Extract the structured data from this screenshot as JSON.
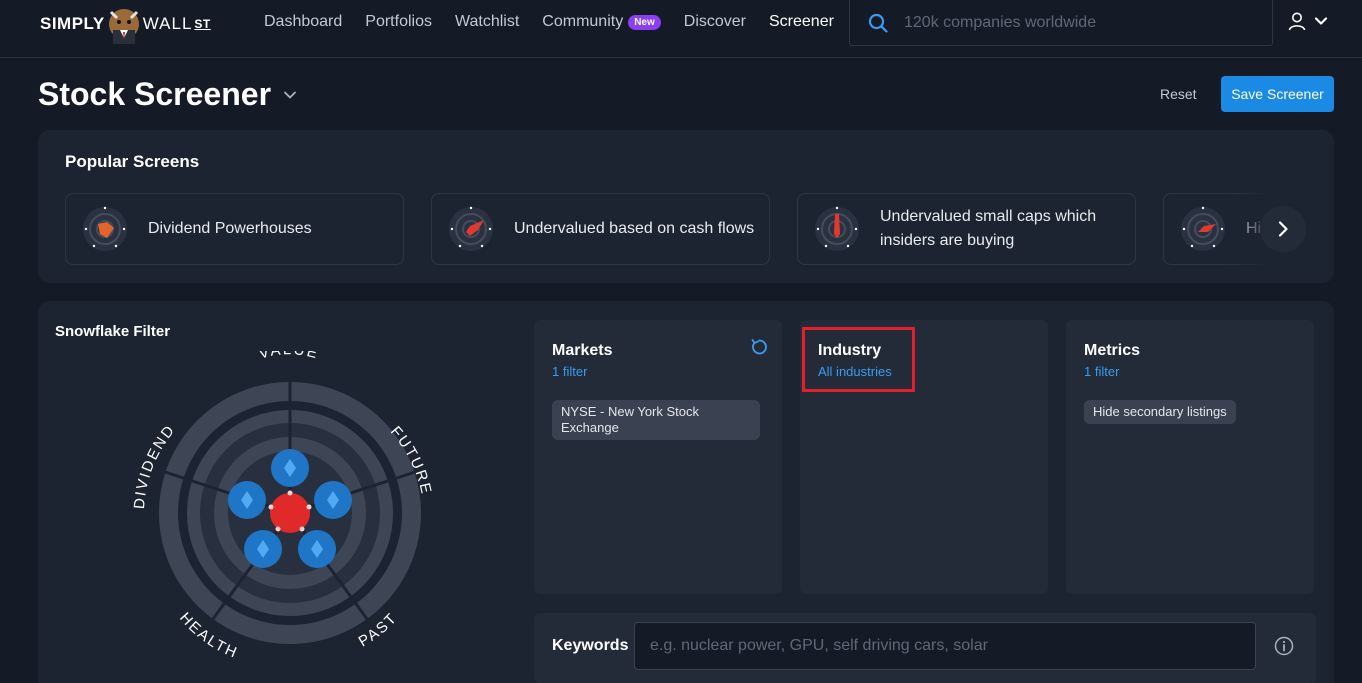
{
  "nav": {
    "logo_left": "SIMPLY",
    "logo_mid": "WALL",
    "logo_right": "ST",
    "links": [
      {
        "label": "Dashboard"
      },
      {
        "label": "Portfolios"
      },
      {
        "label": "Watchlist"
      },
      {
        "label": "Community",
        "badge": "New"
      },
      {
        "label": "Discover"
      },
      {
        "label": "Screener",
        "active": true
      }
    ],
    "search_placeholder": "120k companies worldwide",
    "icons": [
      "search-icon",
      "user-icon",
      "chevron-down-icon"
    ]
  },
  "page": {
    "title": "Stock Screener",
    "reset_label": "Reset",
    "save_label": "Save Screener"
  },
  "popular": {
    "heading": "Popular Screens",
    "screens": [
      {
        "label": "Dividend Powerhouses"
      },
      {
        "label": "Undervalued based on cash flows"
      },
      {
        "label": "Undervalued small caps which insiders are buying"
      },
      {
        "label": "Hi"
      }
    ]
  },
  "snowflake": {
    "title": "Snowflake Filter",
    "axes": [
      "VALUE",
      "FUTURE",
      "PAST",
      "HEALTH",
      "DIVIDEND"
    ]
  },
  "panels": {
    "markets": {
      "title": "Markets",
      "sub": "1 filter",
      "chip": "NYSE - New York Stock Exchange"
    },
    "industry": {
      "title": "Industry",
      "sub": "All industries"
    },
    "metrics": {
      "title": "Metrics",
      "sub": "1 filter",
      "chip": "Hide secondary listings"
    }
  },
  "keywords": {
    "label": "Keywords",
    "placeholder": "e.g. nuclear power, GPU, self driving cars, solar"
  },
  "colors": {
    "background": "#151b26",
    "card": "#1d2431",
    "panel": "#232b38",
    "accent": "#1b8ae4",
    "link": "#3a9cf0",
    "badge": "#8b3ff0",
    "highlight": "#e0202b"
  }
}
